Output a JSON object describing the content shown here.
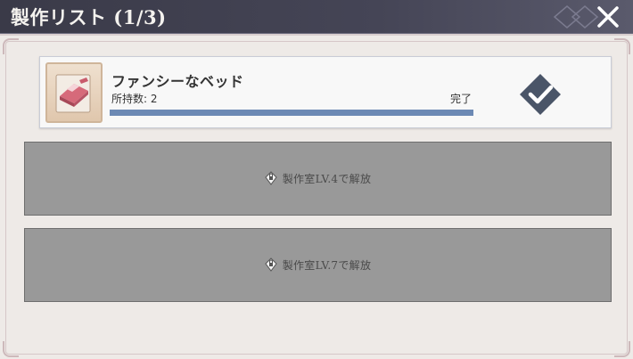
{
  "header": {
    "title": "製作リスト (1/3)"
  },
  "item": {
    "name": "ファンシーなベッド",
    "count_label": "所持数: 2",
    "status": "完了",
    "progress": 1.0,
    "thumbnail_icon": "bed-item-icon",
    "action_icon": "check-icon"
  },
  "locked_slots": [
    {
      "label": "製作室LV.4で解放",
      "icon": "lock-icon"
    },
    {
      "label": "製作室LV.7で解放",
      "icon": "lock-icon"
    }
  ],
  "colors": {
    "header_bg": "#3a3a48",
    "panel_bg": "#eeeae7",
    "progress": "#6c89b4",
    "check_badge": "#4a5568",
    "locked_slot": "#999999"
  }
}
